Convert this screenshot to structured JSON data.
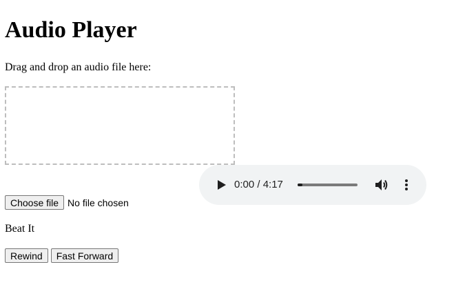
{
  "page": {
    "title": "Audio Player",
    "instructions": "Drag and drop an audio file here:"
  },
  "audio_player": {
    "current_time": "0:00",
    "separator": " / ",
    "duration": "4:17",
    "time_text": "0:00 / 4:17",
    "progress": 0.08,
    "play_icon": "play-icon",
    "volume_icon": "volume-icon",
    "more_icon": "more-vertical-icon"
  },
  "file_input": {
    "button_label": "Choose file",
    "status": "No file chosen"
  },
  "track": {
    "name": "Beat It"
  },
  "controls": {
    "rewind_label": "Rewind",
    "fast_forward_label": "Fast Forward"
  },
  "colors": {
    "player_background": "#f1f3f4",
    "drop_zone_border": "#bdbdbd",
    "button_background": "#efefef"
  }
}
